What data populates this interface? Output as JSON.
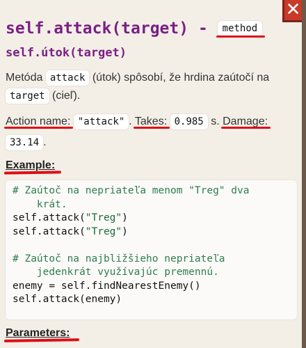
{
  "close": {
    "glyph": "✕"
  },
  "title": {
    "text": "self.attack(target) - ",
    "badge": "method"
  },
  "subtitle": "self.útok(target)",
  "description": {
    "part1": "Metóda ",
    "code1": "attack",
    "part2": " (útok) spôsobí, že hrdina zaútočí na ",
    "code2": "target",
    "part3": " (cieľ)."
  },
  "stats": {
    "action_label": "Action name:",
    "action_value": "\"attack\"",
    "takes_label": "Takes:",
    "takes_value": "0.985",
    "takes_unit": "s.",
    "damage_label": "Damage:",
    "damage_value": "33.14"
  },
  "headings": {
    "example": "Example:",
    "parameters": "Parameters:"
  },
  "example_code": {
    "line1": "# Zaútoč na nepriateľa menom \"Treg\" dva",
    "line2": "    krát.",
    "line3_a": "self.attack(",
    "line3_b": "\"Treg\"",
    "line3_c": ")",
    "line4_a": "self.attack(",
    "line4_b": "\"Treg\"",
    "line4_c": ")",
    "line6": "# Zaútoč na najbližšieho nepriateľa",
    "line7": "    jedenkrát využívajúc premennú.",
    "line8": "enemy = self.findNearestEnemy()",
    "line9": "self.attack(enemy)"
  },
  "colors": {
    "accent": "#7a1f86",
    "annotation": "#e00d17",
    "close": "#c83a2a",
    "comment": "#2f7d4c"
  }
}
